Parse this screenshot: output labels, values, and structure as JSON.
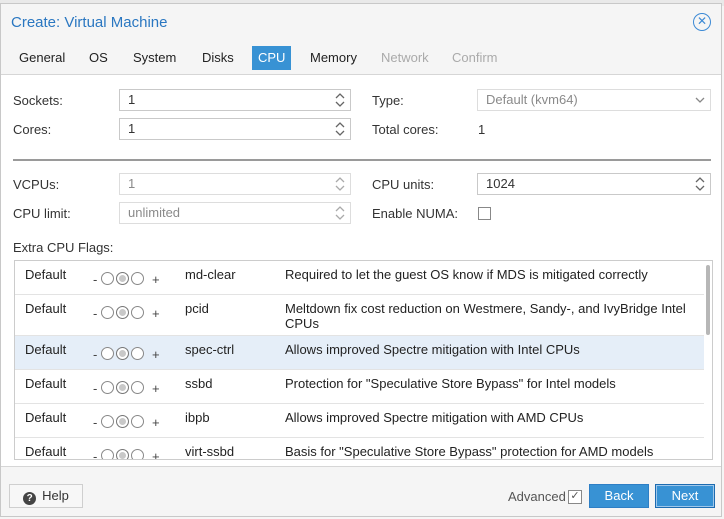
{
  "dialog": {
    "title": "Create: Virtual Machine"
  },
  "tabs": [
    {
      "label": "General",
      "state": "normal"
    },
    {
      "label": "OS",
      "state": "normal"
    },
    {
      "label": "System",
      "state": "normal"
    },
    {
      "label": "Disks",
      "state": "normal"
    },
    {
      "label": "CPU",
      "state": "active"
    },
    {
      "label": "Memory",
      "state": "normal"
    },
    {
      "label": "Network",
      "state": "disabled"
    },
    {
      "label": "Confirm",
      "state": "disabled"
    }
  ],
  "form": {
    "sockets_label": "Sockets:",
    "sockets_value": "1",
    "cores_label": "Cores:",
    "cores_value": "1",
    "type_label": "Type:",
    "type_value": "Default (kvm64)",
    "total_cores_label": "Total cores:",
    "total_cores_value": "1",
    "vcpus_label": "VCPUs:",
    "vcpus_value": "1",
    "cpu_limit_label": "CPU limit:",
    "cpu_limit_value": "unlimited",
    "cpu_units_label": "CPU units:",
    "cpu_units_value": "1024",
    "numa_label": "Enable NUMA:",
    "numa_checked": false
  },
  "flags": {
    "label": "Extra CPU Flags:",
    "minus": "-",
    "plus": "+",
    "rows": [
      {
        "state": "Default",
        "flag": "md-clear",
        "description": "Required to let the guest OS know if MDS is mitigated correctly"
      },
      {
        "state": "Default",
        "flag": "pcid",
        "description": "Meltdown fix cost reduction on Westmere, Sandy-, and IvyBridge Intel CPUs"
      },
      {
        "state": "Default",
        "flag": "spec-ctrl",
        "description": "Allows improved Spectre mitigation with Intel CPUs"
      },
      {
        "state": "Default",
        "flag": "ssbd",
        "description": "Protection for \"Speculative Store Bypass\" for Intel models"
      },
      {
        "state": "Default",
        "flag": "ibpb",
        "description": "Allows improved Spectre mitigation with AMD CPUs"
      },
      {
        "state": "Default",
        "flag": "virt-ssbd",
        "description": "Basis for \"Speculative Store Bypass\" protection for AMD models"
      }
    ]
  },
  "footer": {
    "help_label": "Help",
    "advanced_label": "Advanced",
    "advanced_checked": true,
    "back_label": "Back",
    "next_label": "Next"
  },
  "colors": {
    "accent": "#3892d4",
    "title": "#2a77c1"
  }
}
